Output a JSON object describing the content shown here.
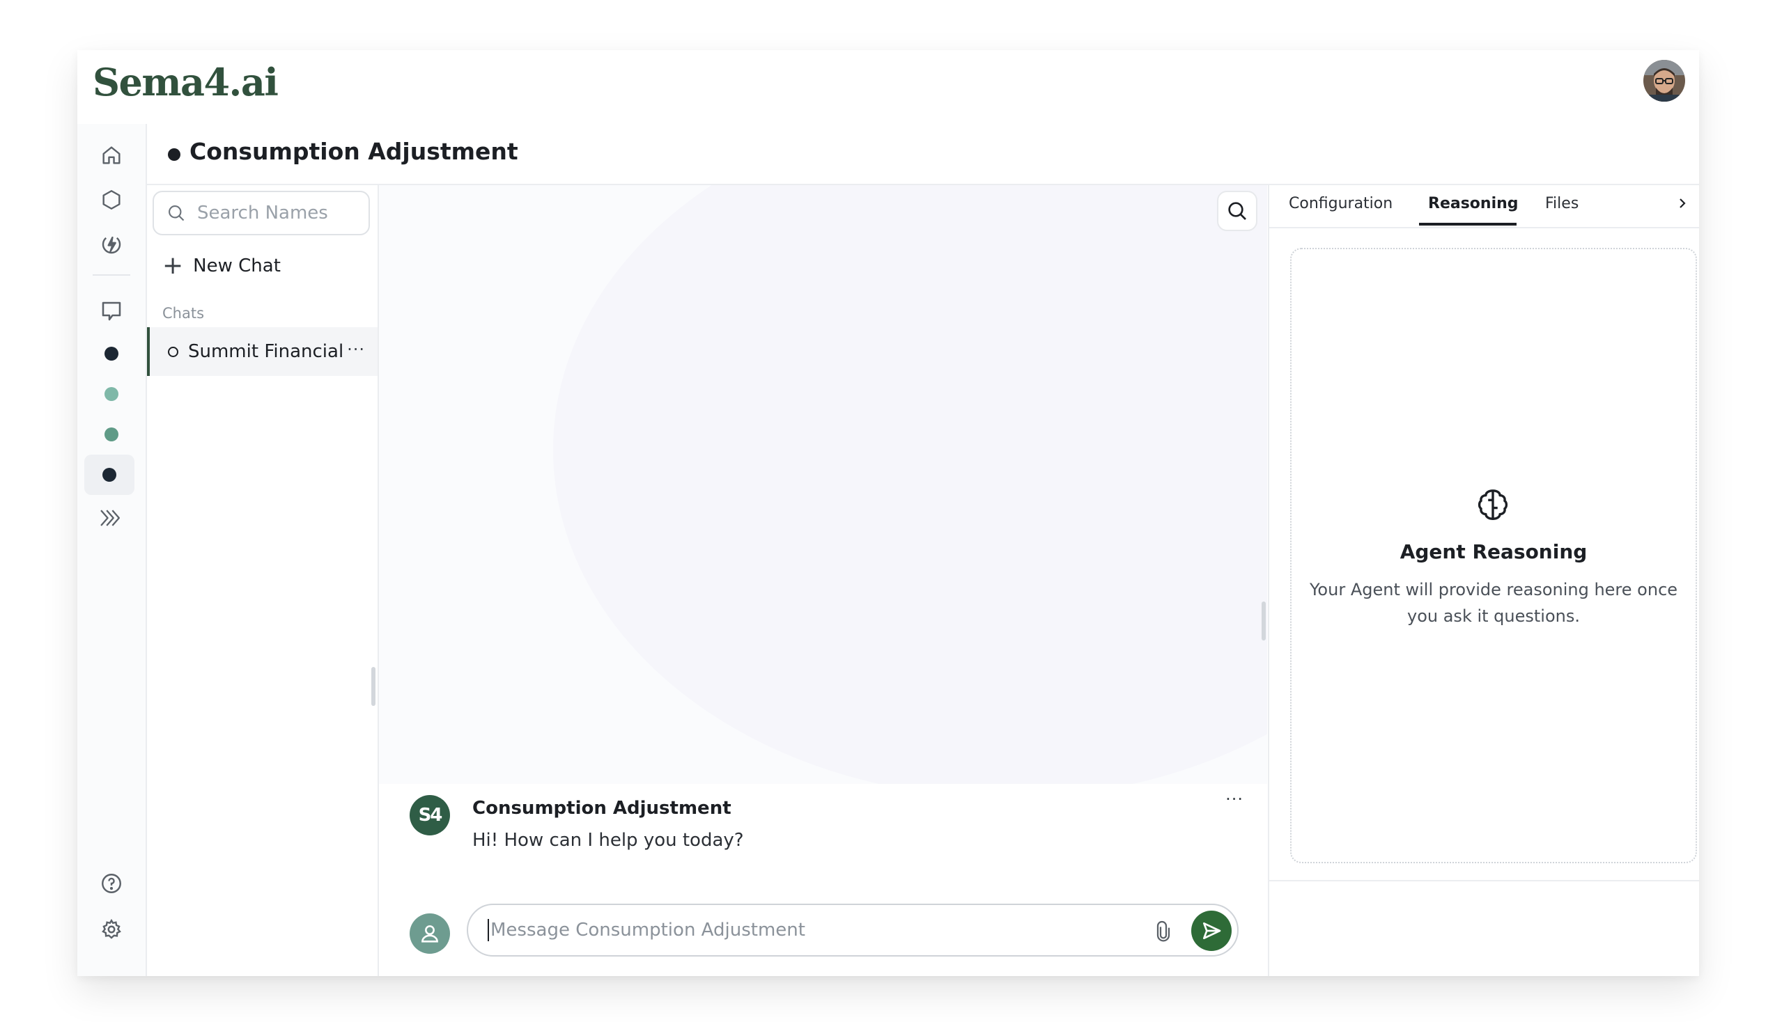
{
  "app": {
    "logo_text": "Sema4.ai",
    "user_avatar_icon": "user-photo-avatar"
  },
  "rail": {
    "items": [
      {
        "icon": "home-icon"
      },
      {
        "icon": "hexagon-icon"
      },
      {
        "icon": "lightning-icon"
      },
      {
        "icon": "chat-bubble-icon"
      },
      {
        "icon": "agent-dot",
        "color": "#1c2733"
      },
      {
        "icon": "agent-dot",
        "color": "#7fb8a8"
      },
      {
        "icon": "agent-dot",
        "color": "#5f9b87"
      },
      {
        "icon": "agent-dot",
        "color": "#1c2733",
        "active": true
      },
      {
        "icon": "double-chevron-icon"
      }
    ],
    "bottom": [
      {
        "icon": "help-icon"
      },
      {
        "icon": "settings-icon"
      }
    ]
  },
  "agent": {
    "title": "Consumption Adjustment",
    "status_color": "#1c1f24"
  },
  "chatlist": {
    "search_placeholder": "Search Names",
    "new_chat_label": "New Chat",
    "section_label": "Chats",
    "items": [
      {
        "name": "Summit Financial",
        "more": "···",
        "active": true
      }
    ]
  },
  "conversation": {
    "messages": [
      {
        "author": "Consumption Adjustment",
        "avatar_text": "S4",
        "text": "Hi! How can I help you today?",
        "more": "···"
      }
    ],
    "composer_placeholder": "Message Consumption Adjustment",
    "send_color": "#2e6b37"
  },
  "panel": {
    "tabs": [
      {
        "label": "Configuration",
        "active": false
      },
      {
        "label": "Reasoning",
        "active": true
      },
      {
        "label": "Files",
        "active": false
      }
    ],
    "reasoning_title": "Agent Reasoning",
    "reasoning_desc": "Your Agent will provide reasoning here once you ask it questions."
  },
  "colors": {
    "brand": "#31513d",
    "accent": "#2e6b37"
  }
}
